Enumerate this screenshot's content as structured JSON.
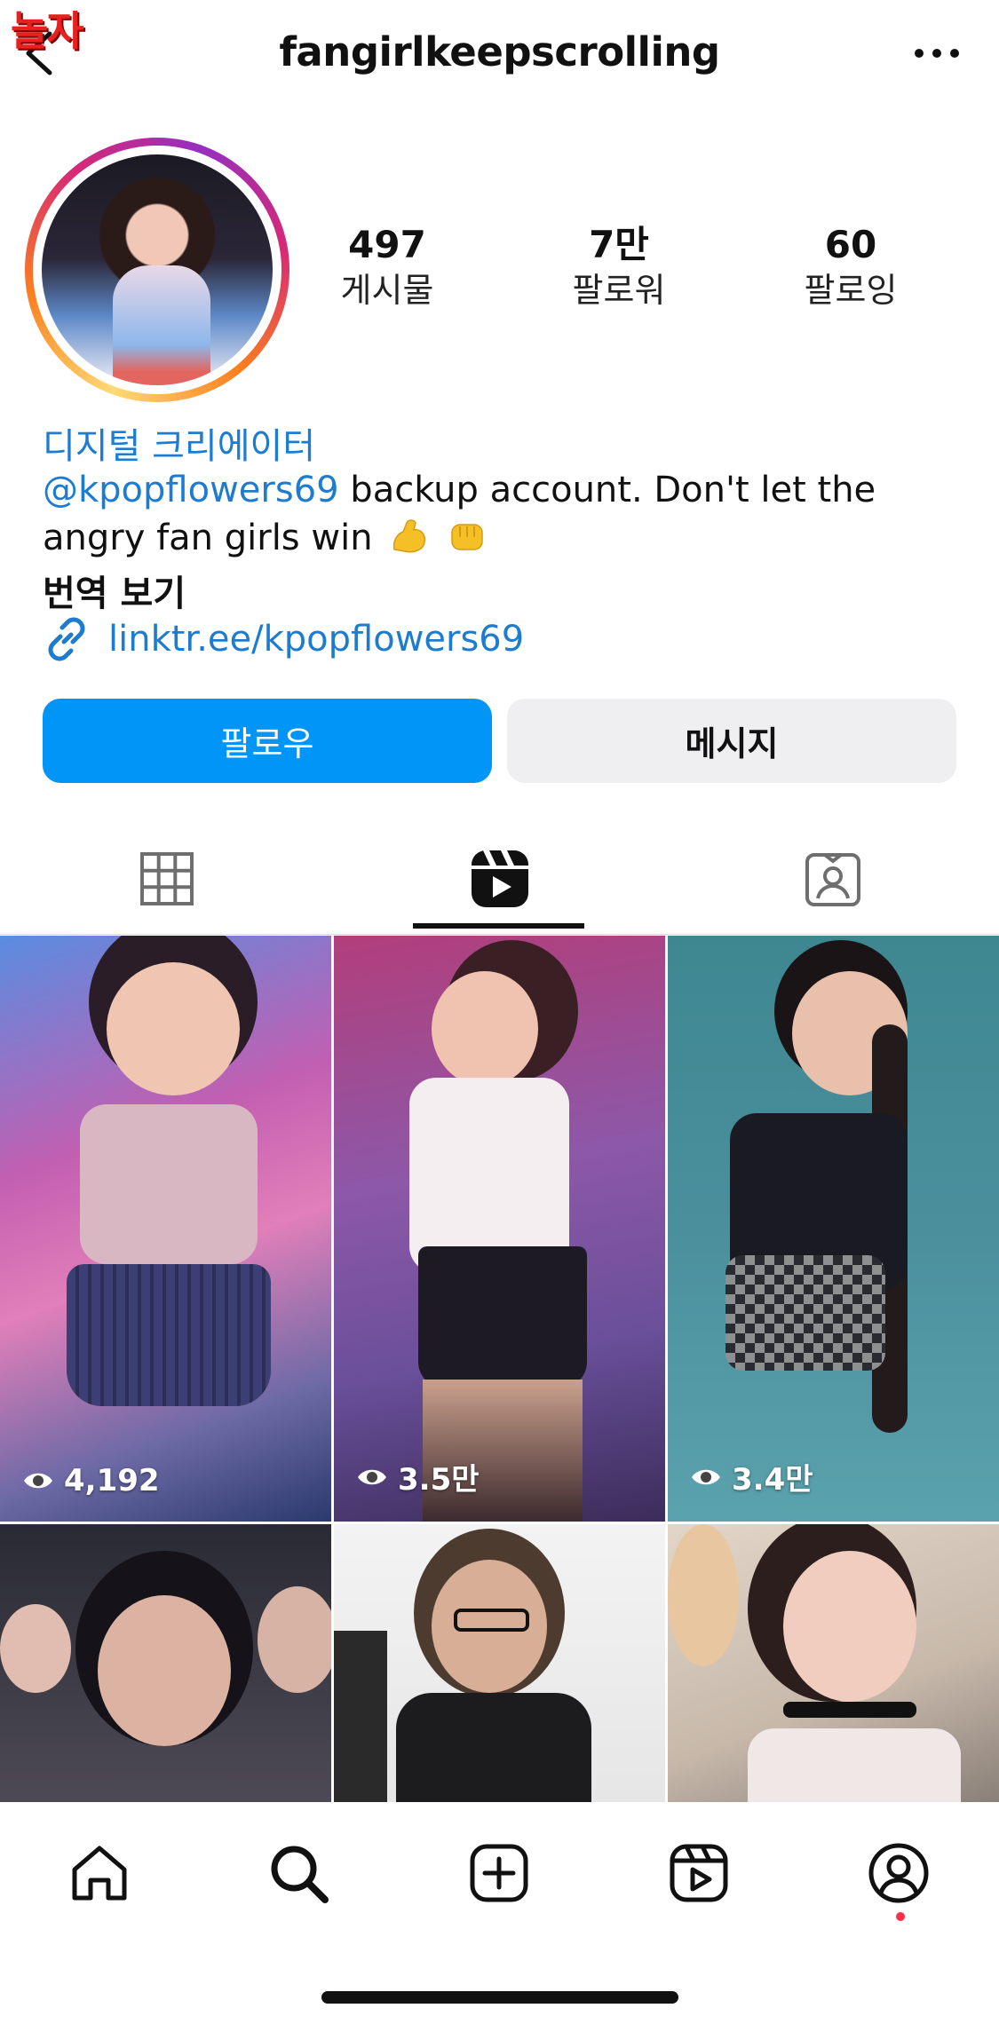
{
  "watermark": "놀자",
  "header": {
    "username": "fangirlkeepscrolling",
    "back_icon": "chevron-left-icon",
    "more_icon": "more-horizontal-icon"
  },
  "profile": {
    "stats": [
      {
        "value": "497",
        "label": "게시물"
      },
      {
        "value": "7만",
        "label": "팔로워"
      },
      {
        "value": "60",
        "label": "팔로잉"
      }
    ],
    "category": "디지털 크리에이터",
    "bio_mention": "@kpopflowers69",
    "bio_text_1": " backup account. Don't let the",
    "bio_text_2": "angry fan girls win",
    "bio_emojis": [
      "flexed-biceps-emoji",
      "oncoming-fist-emoji"
    ],
    "translate_label": "번역 보기",
    "link_text": "linktr.ee/kpopflowers69"
  },
  "buttons": {
    "follow": "팔로우",
    "message": "메시지"
  },
  "tabs": [
    {
      "name": "grid-icon",
      "active": false
    },
    {
      "name": "reels-icon",
      "active": true
    },
    {
      "name": "tagged-icon",
      "active": false
    }
  ],
  "reels": [
    {
      "views": "4,192"
    },
    {
      "views": "3.5만"
    },
    {
      "views": "3.4만"
    },
    {
      "views": ""
    },
    {
      "views": ""
    },
    {
      "views": ""
    }
  ],
  "bottom_nav": [
    "home-icon",
    "search-icon",
    "create-icon",
    "reels-icon",
    "profile-icon"
  ],
  "colors": {
    "accent": "#0095f6",
    "link": "#1d7ccf",
    "notification_dot": "#ff2d4c"
  }
}
